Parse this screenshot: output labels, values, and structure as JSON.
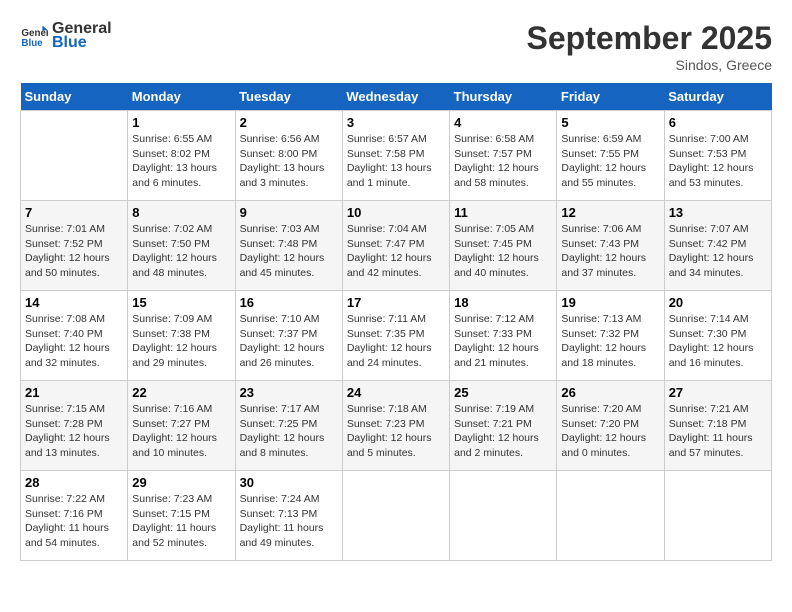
{
  "header": {
    "logo_general": "General",
    "logo_blue": "Blue",
    "month_title": "September 2025",
    "location": "Sindos, Greece"
  },
  "days_of_week": [
    "Sunday",
    "Monday",
    "Tuesday",
    "Wednesday",
    "Thursday",
    "Friday",
    "Saturday"
  ],
  "weeks": [
    [
      {
        "day": "",
        "info": ""
      },
      {
        "day": "1",
        "info": "Sunrise: 6:55 AM\nSunset: 8:02 PM\nDaylight: 13 hours\nand 6 minutes."
      },
      {
        "day": "2",
        "info": "Sunrise: 6:56 AM\nSunset: 8:00 PM\nDaylight: 13 hours\nand 3 minutes."
      },
      {
        "day": "3",
        "info": "Sunrise: 6:57 AM\nSunset: 7:58 PM\nDaylight: 13 hours\nand 1 minute."
      },
      {
        "day": "4",
        "info": "Sunrise: 6:58 AM\nSunset: 7:57 PM\nDaylight: 12 hours\nand 58 minutes."
      },
      {
        "day": "5",
        "info": "Sunrise: 6:59 AM\nSunset: 7:55 PM\nDaylight: 12 hours\nand 55 minutes."
      },
      {
        "day": "6",
        "info": "Sunrise: 7:00 AM\nSunset: 7:53 PM\nDaylight: 12 hours\nand 53 minutes."
      }
    ],
    [
      {
        "day": "7",
        "info": "Sunrise: 7:01 AM\nSunset: 7:52 PM\nDaylight: 12 hours\nand 50 minutes."
      },
      {
        "day": "8",
        "info": "Sunrise: 7:02 AM\nSunset: 7:50 PM\nDaylight: 12 hours\nand 48 minutes."
      },
      {
        "day": "9",
        "info": "Sunrise: 7:03 AM\nSunset: 7:48 PM\nDaylight: 12 hours\nand 45 minutes."
      },
      {
        "day": "10",
        "info": "Sunrise: 7:04 AM\nSunset: 7:47 PM\nDaylight: 12 hours\nand 42 minutes."
      },
      {
        "day": "11",
        "info": "Sunrise: 7:05 AM\nSunset: 7:45 PM\nDaylight: 12 hours\nand 40 minutes."
      },
      {
        "day": "12",
        "info": "Sunrise: 7:06 AM\nSunset: 7:43 PM\nDaylight: 12 hours\nand 37 minutes."
      },
      {
        "day": "13",
        "info": "Sunrise: 7:07 AM\nSunset: 7:42 PM\nDaylight: 12 hours\nand 34 minutes."
      }
    ],
    [
      {
        "day": "14",
        "info": "Sunrise: 7:08 AM\nSunset: 7:40 PM\nDaylight: 12 hours\nand 32 minutes."
      },
      {
        "day": "15",
        "info": "Sunrise: 7:09 AM\nSunset: 7:38 PM\nDaylight: 12 hours\nand 29 minutes."
      },
      {
        "day": "16",
        "info": "Sunrise: 7:10 AM\nSunset: 7:37 PM\nDaylight: 12 hours\nand 26 minutes."
      },
      {
        "day": "17",
        "info": "Sunrise: 7:11 AM\nSunset: 7:35 PM\nDaylight: 12 hours\nand 24 minutes."
      },
      {
        "day": "18",
        "info": "Sunrise: 7:12 AM\nSunset: 7:33 PM\nDaylight: 12 hours\nand 21 minutes."
      },
      {
        "day": "19",
        "info": "Sunrise: 7:13 AM\nSunset: 7:32 PM\nDaylight: 12 hours\nand 18 minutes."
      },
      {
        "day": "20",
        "info": "Sunrise: 7:14 AM\nSunset: 7:30 PM\nDaylight: 12 hours\nand 16 minutes."
      }
    ],
    [
      {
        "day": "21",
        "info": "Sunrise: 7:15 AM\nSunset: 7:28 PM\nDaylight: 12 hours\nand 13 minutes."
      },
      {
        "day": "22",
        "info": "Sunrise: 7:16 AM\nSunset: 7:27 PM\nDaylight: 12 hours\nand 10 minutes."
      },
      {
        "day": "23",
        "info": "Sunrise: 7:17 AM\nSunset: 7:25 PM\nDaylight: 12 hours\nand 8 minutes."
      },
      {
        "day": "24",
        "info": "Sunrise: 7:18 AM\nSunset: 7:23 PM\nDaylight: 12 hours\nand 5 minutes."
      },
      {
        "day": "25",
        "info": "Sunrise: 7:19 AM\nSunset: 7:21 PM\nDaylight: 12 hours\nand 2 minutes."
      },
      {
        "day": "26",
        "info": "Sunrise: 7:20 AM\nSunset: 7:20 PM\nDaylight: 12 hours\nand 0 minutes."
      },
      {
        "day": "27",
        "info": "Sunrise: 7:21 AM\nSunset: 7:18 PM\nDaylight: 11 hours\nand 57 minutes."
      }
    ],
    [
      {
        "day": "28",
        "info": "Sunrise: 7:22 AM\nSunset: 7:16 PM\nDaylight: 11 hours\nand 54 minutes."
      },
      {
        "day": "29",
        "info": "Sunrise: 7:23 AM\nSunset: 7:15 PM\nDaylight: 11 hours\nand 52 minutes."
      },
      {
        "day": "30",
        "info": "Sunrise: 7:24 AM\nSunset: 7:13 PM\nDaylight: 11 hours\nand 49 minutes."
      },
      {
        "day": "",
        "info": ""
      },
      {
        "day": "",
        "info": ""
      },
      {
        "day": "",
        "info": ""
      },
      {
        "day": "",
        "info": ""
      }
    ]
  ]
}
